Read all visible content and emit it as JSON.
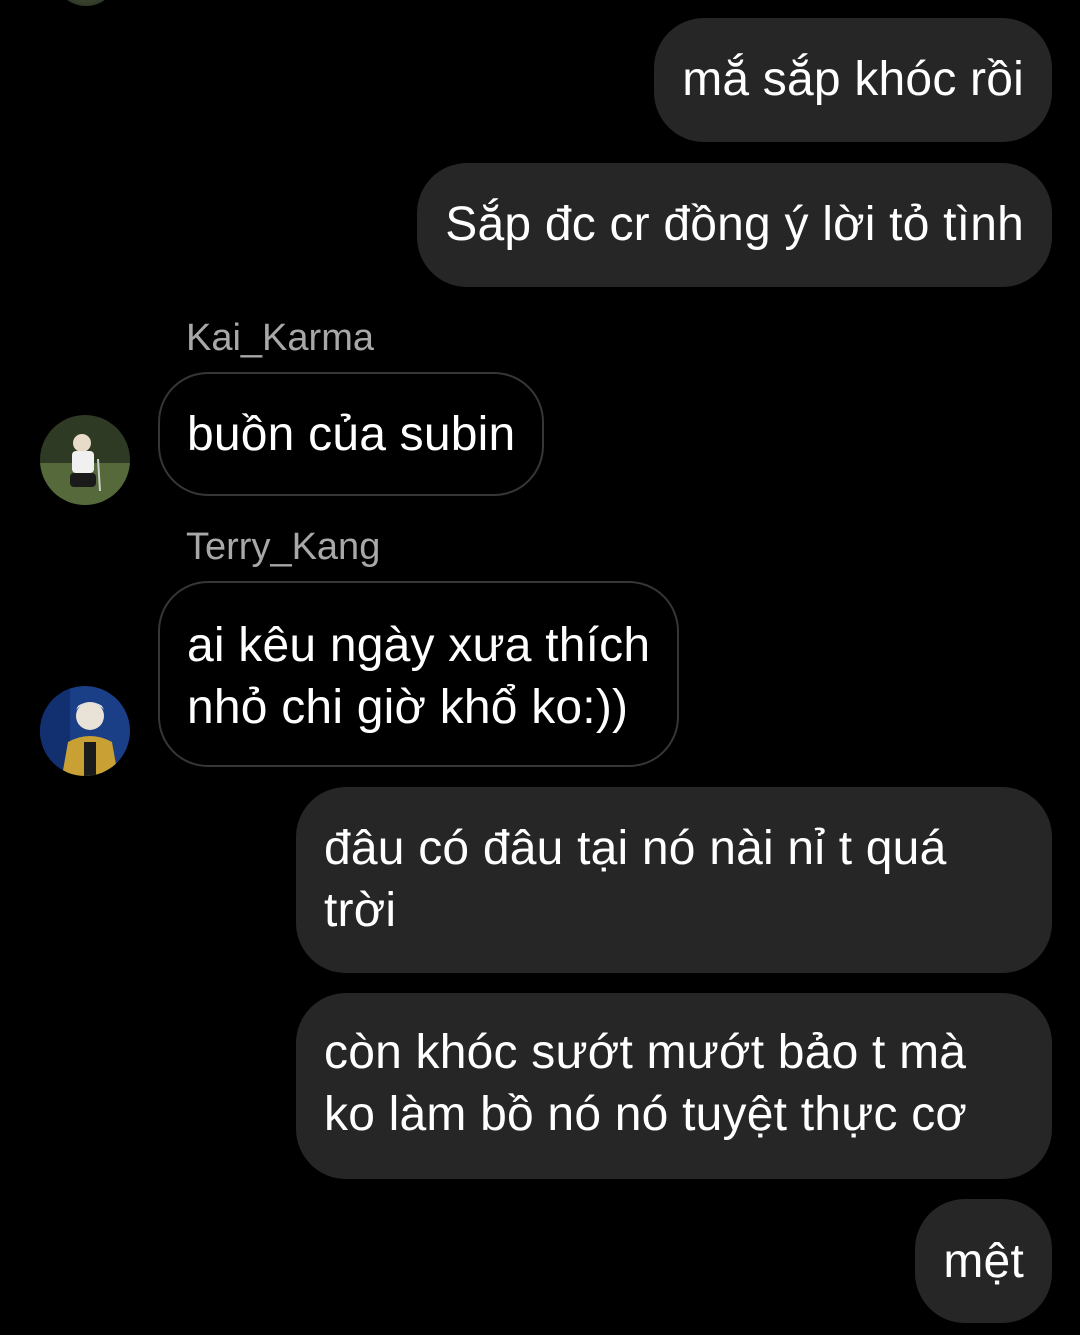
{
  "conversation": {
    "messages": [
      {
        "id": "m1",
        "direction": "sent",
        "lines": [
          "mắ sắp khóc rồi"
        ]
      },
      {
        "id": "m2",
        "direction": "sent",
        "lines": [
          "Sắp đc cr đồng ý lời tỏ tình"
        ]
      },
      {
        "id": "m3",
        "direction": "received",
        "sender": "Kai_Karma",
        "avatar_icon": "user-avatar-icon",
        "lines": [
          "buồn của subin"
        ]
      },
      {
        "id": "m4",
        "direction": "received",
        "sender": "Terry_Kang",
        "avatar_icon": "user-avatar-icon",
        "lines": [
          "ai kêu ngày xưa thích",
          "nhỏ chi giờ khổ ko:))"
        ]
      },
      {
        "id": "m5",
        "direction": "sent",
        "lines": [
          "đâu có đâu tại nó nài nỉ t quá",
          "trời"
        ]
      },
      {
        "id": "m6",
        "direction": "sent",
        "lines": [
          "còn khóc sướt mướt bảo t mà",
          "ko làm bồ nó nó tuyệt thực cơ"
        ]
      },
      {
        "id": "m7",
        "direction": "sent",
        "lines": [
          "mệt"
        ]
      }
    ]
  },
  "colors": {
    "background": "#000000",
    "sent_bubble": "#262626",
    "received_bubble_border": "#363636",
    "sender_name": "#a8a8a8",
    "text": "#ffffff"
  }
}
